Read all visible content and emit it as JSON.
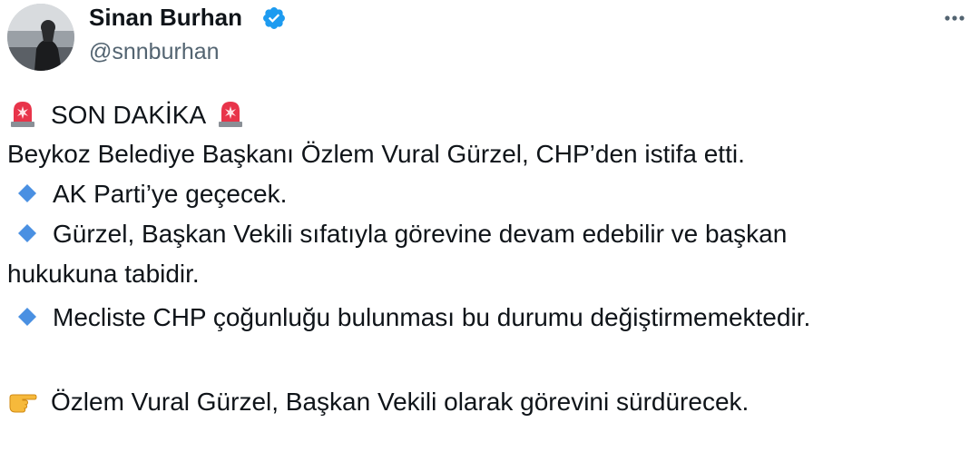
{
  "author": {
    "name": "Sinan Burhan",
    "handle": "@snnburhan",
    "verified": true,
    "verified_color": "#1d9bf0"
  },
  "icons": {
    "more": "more-horizontal-icon",
    "alert": "police-light-emoji",
    "bullet": "blue-diamond-emoji",
    "pointer": "pointing-hand-emoji"
  },
  "tweet": {
    "line1": "SON DAKİKA",
    "line2": "Beykoz Belediye Başkanı Özlem Vural Gürzel, CHP’den istifa etti.",
    "bullet1": "AK Parti’ye geçecek.",
    "bullet2_part1": "Gürzel, Başkan Vekili sıfatıyla görevine devam edebilir ve başkan",
    "bullet2_part2": "hukukuna tabidir.",
    "bullet3": "Mecliste CHP çoğunluğu bulunması bu durumu değiştirmemektedir.",
    "closing": "Özlem Vural Gürzel, Başkan Vekili olarak görevini sürdürecek."
  },
  "colors": {
    "text": "#0f1419",
    "secondary": "#536471",
    "diamond": "#4a90e2",
    "alert_red": "#e8344a"
  }
}
